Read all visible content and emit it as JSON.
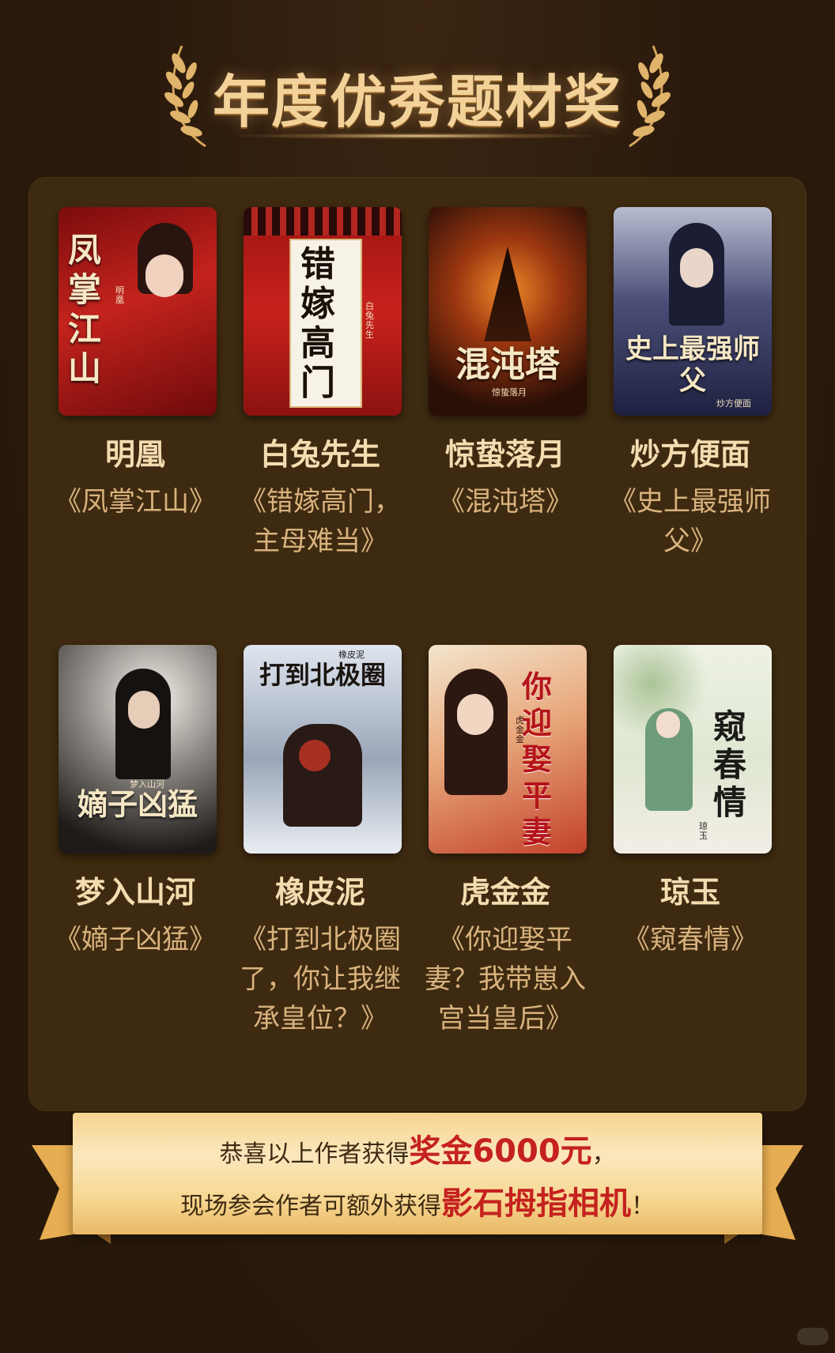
{
  "header": {
    "title": "年度优秀题材奖"
  },
  "winners": [
    {
      "author": "明凰",
      "book": "《凤掌江山》",
      "cover_title": "凤掌江山",
      "cover_author": "明凰"
    },
    {
      "author": "白兔先生",
      "book": "《错嫁高门，主母难当》",
      "cover_title": "错嫁高门",
      "cover_author": "白兔先生"
    },
    {
      "author": "惊蛰落月",
      "book": "《混沌塔》",
      "cover_title": "混沌塔",
      "cover_author": "惊蛰落月"
    },
    {
      "author": "炒方便面",
      "book": "《史上最强师父》",
      "cover_title": "史上最强师父",
      "cover_author": "炒方便面"
    },
    {
      "author": "梦入山河",
      "book": "《嫡子凶猛》",
      "cover_title": "嫡子凶猛",
      "cover_author": "梦入山河"
    },
    {
      "author": "橡皮泥",
      "book": "《打到北极圈了，你让我继承皇位？》",
      "cover_title": "打到北极圈",
      "cover_author": "橡皮泥"
    },
    {
      "author": "虎金金",
      "book": "《你迎娶平妻？我带崽入宫当皇后》",
      "cover_title": "你迎娶平妻",
      "cover_author": "虎金金"
    },
    {
      "author": "琼玉",
      "book": "《窥春情》",
      "cover_title": "窥春情",
      "cover_author": "琼玉"
    }
  ],
  "ribbon": {
    "line1_prefix": "恭喜以上作者获得",
    "line1_highlight": "奖金6000元",
    "line1_suffix": "，",
    "line2_prefix": "现场参会作者可额外获得",
    "line2_highlight": "影石拇指相机",
    "line2_suffix": "！"
  },
  "colors": {
    "background": "#2b1a0c",
    "panel": "#3e2a10",
    "author_name": "#f4dcb1",
    "book_title": "#d9b37e",
    "highlight": "#c5221f"
  }
}
